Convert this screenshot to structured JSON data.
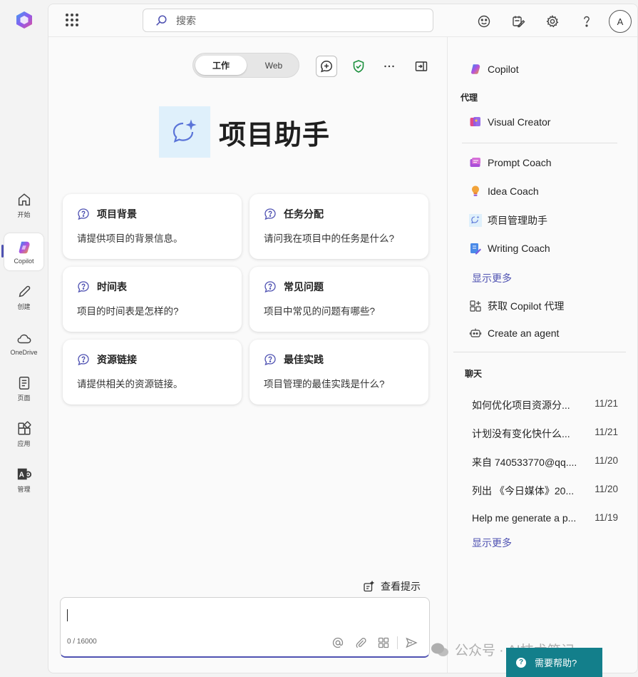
{
  "rail": {
    "items": [
      {
        "label": "开始",
        "icon": "home-icon"
      },
      {
        "label": "Copilot",
        "icon": "copilot-icon"
      },
      {
        "label": "创建",
        "icon": "pencil-icon"
      },
      {
        "label": "OneDrive",
        "icon": "cloud-icon"
      },
      {
        "label": "页面",
        "icon": "page-icon"
      },
      {
        "label": "应用",
        "icon": "apps-icon"
      },
      {
        "label": "管理",
        "icon": "admin-icon"
      }
    ]
  },
  "header": {
    "search_placeholder": "搜索",
    "avatar_initial": "A"
  },
  "mode_toggle": {
    "work_label": "工作",
    "web_label": "Web",
    "selected": "工作"
  },
  "agent": {
    "title": "项目助手"
  },
  "prompt_cards": [
    {
      "title": "项目背景",
      "text": "请提供项目的背景信息。"
    },
    {
      "title": "任务分配",
      "text": "请问我在项目中的任务是什么?"
    },
    {
      "title": "时间表",
      "text": "项目的时间表是怎样的?"
    },
    {
      "title": "常见问题",
      "text": "项目中常见的问题有哪些?"
    },
    {
      "title": "资源链接",
      "text": "请提供相关的资源链接。"
    },
    {
      "title": "最佳实践",
      "text": "项目管理的最佳实践是什么?"
    }
  ],
  "composer": {
    "view_prompts_label": "查看提示",
    "counter": "0 / 16000"
  },
  "right_panel": {
    "copilot_label": "Copilot",
    "agents_heading": "代理",
    "agents": [
      {
        "label": "Visual Creator"
      },
      {
        "label": "Prompt Coach"
      },
      {
        "label": "Idea Coach"
      },
      {
        "label": "项目管理助手"
      },
      {
        "label": "Writing Coach"
      }
    ],
    "show_more": "显示更多",
    "get_agents": "获取 Copilot 代理",
    "create_agent": "Create an agent",
    "chats_heading": "聊天",
    "chats": [
      {
        "title": "如何优化项目资源分...",
        "date": "11/21"
      },
      {
        "title": "计划没有变化快什么...",
        "date": "11/21"
      },
      {
        "title": "来自 740533770@qq....",
        "date": "11/20"
      },
      {
        "title": "列出 《今日媒体》20...",
        "date": "11/20"
      },
      {
        "title": "Help me generate a p...",
        "date": "11/19"
      }
    ],
    "chats_show_more": "显示更多"
  },
  "help_button": "需要帮助?",
  "watermark": "公众号 · AI技术笔记",
  "colors": {
    "accent": "#4f52b2",
    "help_bg": "#137f8b",
    "agent_icon_bg": "#dff0fb"
  }
}
